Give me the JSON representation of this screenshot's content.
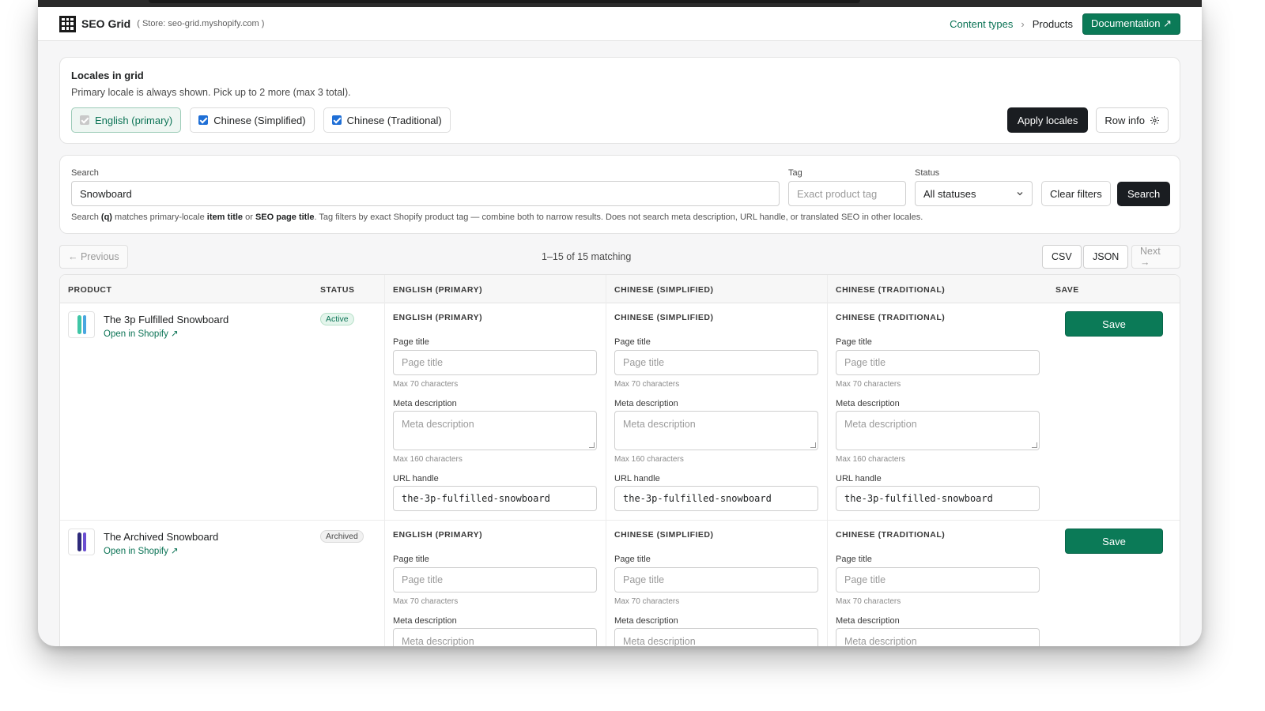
{
  "app": {
    "title": "SEO Grid",
    "store_label": "( Store: seo-grid.myshopify.com )"
  },
  "nav": {
    "crumb_content_types": "Content types",
    "crumb_separator": "›",
    "crumb_current": "Products",
    "documentation": "Documentation ↗"
  },
  "locales": {
    "title": "Locales in grid",
    "subtitle": "Primary locale is always shown. Pick up to 2 more (max 3 total).",
    "chips": [
      {
        "label": "English (primary)",
        "checked": true,
        "disabled": true
      },
      {
        "label": "Chinese (Simplified)",
        "checked": true
      },
      {
        "label": "Chinese (Traditional)",
        "checked": true
      }
    ],
    "apply_label": "Apply locales",
    "row_info_label": "Row info",
    "row_info_icon": "gear-icon"
  },
  "search": {
    "search_label": "Search",
    "search_value": "Snowboard",
    "tag_label": "Tag",
    "tag_placeholder": "Exact product tag",
    "status_label": "Status",
    "status_value": "All statuses",
    "clear_label": "Clear filters",
    "search_button": "Search",
    "help": {
      "p1": "Search ",
      "b1": "(q)",
      "p2": " matches primary-locale ",
      "b2": "item title",
      "p3": " or ",
      "b3": "SEO page title",
      "p4": ". Tag filters by exact Shopify product tag — combine both to narrow results. Does not search meta description, URL handle, or translated SEO in other locales."
    }
  },
  "pager": {
    "previous": "← Previous",
    "count": "1–15 of 15 matching",
    "csv": "CSV",
    "json": "JSON",
    "next": "Next →"
  },
  "table": {
    "headers": {
      "product": "PRODUCT",
      "status": "STATUS",
      "english": "ENGLISH (PRIMARY)",
      "chinese_simplified": "CHINESE (SIMPLIFIED)",
      "chinese_traditional": "CHINESE (TRADITIONAL)",
      "save": "SAVE"
    },
    "field_labels": {
      "page_title": "Page title",
      "page_title_placeholder": "Page title",
      "page_title_hint": "Max 70 characters",
      "meta_description": "Meta description",
      "meta_description_placeholder": "Meta description",
      "meta_description_hint": "Max 160 characters",
      "url_handle": "URL handle"
    },
    "rows": [
      {
        "name": "The 3p Fulfilled Snowboard",
        "link": "Open in Shopify ↗",
        "status": "Active",
        "url_handle": "the-3p-fulfilled-snowboard",
        "save": "Save",
        "locale_heads": [
          "ENGLISH (PRIMARY)",
          "CHINESE (SIMPLIFIED)",
          "CHINESE (TRADITIONAL)"
        ],
        "thumb_colors": [
          "#3fc6a6",
          "#49a7e0"
        ]
      },
      {
        "name": "The Archived Snowboard",
        "link": "Open in Shopify ↗",
        "status": "Archived",
        "save": "Save",
        "locale_heads": [
          "ENGLISH (PRIMARY)",
          "CHINESE (SIMPLIFIED)",
          "CHINESE (TRADITIONAL)"
        ],
        "thumb_colors": [
          "#2d2a7a",
          "#6b4fd1"
        ]
      }
    ]
  },
  "colors": {
    "brand_green": "#0b7a57",
    "dark_button": "#1a1d21"
  }
}
